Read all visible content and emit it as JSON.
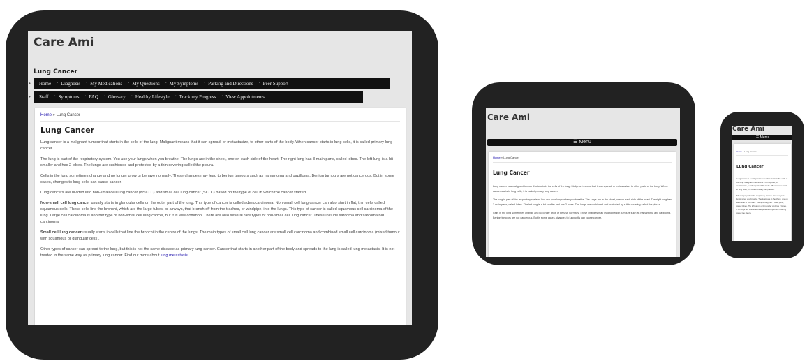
{
  "site_title": "Care Ami",
  "section_label": "Lung Cancer",
  "nav_row1": [
    "Home",
    "Diagnosis",
    "My Medications",
    "My Questions",
    "My Symptoms",
    "Parking and Directions",
    "Peer Support"
  ],
  "nav_row2": [
    "Staff",
    "Symptoms",
    "FAQ",
    "Glossary",
    "Healthy Lifestyle",
    "Track my Progress",
    "View Appointments"
  ],
  "menu_label": "☰ Menu",
  "breadcrumb": {
    "home": "Home",
    "sep": " » ",
    "current": "Lung Cancer"
  },
  "page_title": "Lung Cancer",
  "paragraphs": {
    "p1": "Lung cancer is a malignant tumour that starts in the cells of the lung. Malignant means that it can spread, or metastasize, to other parts of the body. When cancer starts in lung cells, it is called primary lung cancer.",
    "p2": "The lung is part of the respiratory system. You use your lungs when you breathe. The lungs are in the chest, one on each side of the heart. The right lung has 3 main parts, called lobes. The left lung is a bit smaller and has 2 lobes. The lungs are cushioned and protected by a thin covering called the pleura.",
    "p3": "Cells in the lung sometimes change and no longer grow or behave normally. These changes may lead to benign tumours such as hamartoma and papilloma. Benign tumours are not cancerous. But in some cases, changes to lung cells can cause cancer.",
    "p4": "Lung cancers are divided into non-small cell lung cancer (NSCLC) and small cell lung cancer (SCLC) based on the type of cell in which the cancer started.",
    "p5_bold": "Non-small cell lung cancer",
    "p5": " usually starts in glandular cells on the outer part of the lung. This type of cancer is called adenocarcinoma. Non-small cell lung cancer can also start in flat, thin cells called squamous cells. These cells line the bronchi, which are the large tubes, or airways, that branch off from the trachea, or windpipe, into the lungs. This type of cancer is called squamous cell carcinoma of the lung. Large cell carcinoma is another type of non-small cell lung cancer, but it is less common. There are also several rare types of non-small cell lung cancer. These include sarcoma and sarcomatoid carcinoma.",
    "p6_bold": "Small cell lung cancer",
    "p6": " usually starts in cells that line the bronchi in the centre of the lungs. The main types of small cell lung cancer are small cell carcinoma and combined small cell carcinoma (mixed tumour with squamous or glandular cells).",
    "p7": "Other types of cancer can spread to the lung, but this is not the same disease as primary lung cancer. Cancer that starts in another part of the body and spreads to the lung is called lung metastasis. It is not treated in the same way as primary lung cancer. Find out more about ",
    "p7_link": "lung metastasis",
    "p7_end": "."
  },
  "colors": {
    "device": "#222222",
    "nav_bg": "#111111",
    "link": "#1a0dab",
    "page_bg": "#e6e6e6"
  }
}
